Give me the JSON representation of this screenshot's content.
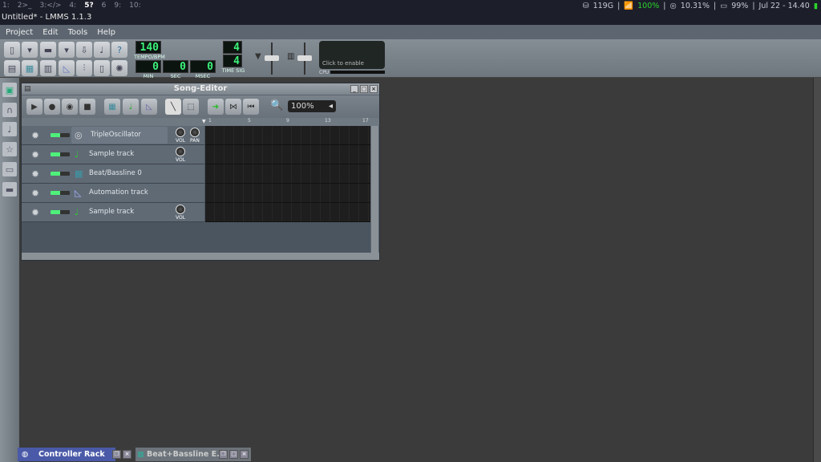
{
  "topbar": {
    "workspaces": [
      "1:",
      "2>_",
      "3:</>",
      "4:",
      "5?",
      "6",
      "9:",
      "10:"
    ],
    "active": "5?",
    "status": {
      "disk": "119G",
      "wifi": "100%",
      "cpu": "10.31%",
      "battery": "99%",
      "datetime": "Jul 22 - 14.40"
    }
  },
  "window_title": "Untitled* - LMMS 1.1.3",
  "menu": [
    "Project",
    "Edit",
    "Tools",
    "Help"
  ],
  "toolbar": {
    "tempo": "140",
    "tempo_label": "TEMPO/BPM",
    "min": "0",
    "sec": "0",
    "msec": "0",
    "min_label": "MIN",
    "sec_label": "SEC",
    "msec_label": "MSEC",
    "timesig_num": "4",
    "timesig_den": "4",
    "timesig_label": "TIME SIG",
    "cpu_hint": "Click to enable",
    "cpu_label": "CPU"
  },
  "song_editor": {
    "title": "Song-Editor",
    "zoom": "100%",
    "ruler": [
      "1",
      "5",
      "9",
      "13",
      "17"
    ],
    "tracks": [
      {
        "name": "TripleOscillator",
        "icon": "oscillator-icon",
        "knobs": [
          "VOL",
          "PAN"
        ]
      },
      {
        "name": "Sample track",
        "icon": "note-icon",
        "knobs": [
          "VOL"
        ]
      },
      {
        "name": "Beat/Bassline 0",
        "icon": "beat-icon",
        "knobs": []
      },
      {
        "name": "Automation track",
        "icon": "automation-icon",
        "knobs": []
      },
      {
        "name": "Sample track",
        "icon": "note-icon",
        "knobs": [
          "VOL"
        ]
      }
    ]
  },
  "bottom_tabs": [
    "Controller Rack",
    "Beat+Bassline E..."
  ],
  "colors": {
    "lcd": "#3cf07a",
    "wifi": "#2bd52b",
    "active_tab": "#4a5aa8"
  }
}
